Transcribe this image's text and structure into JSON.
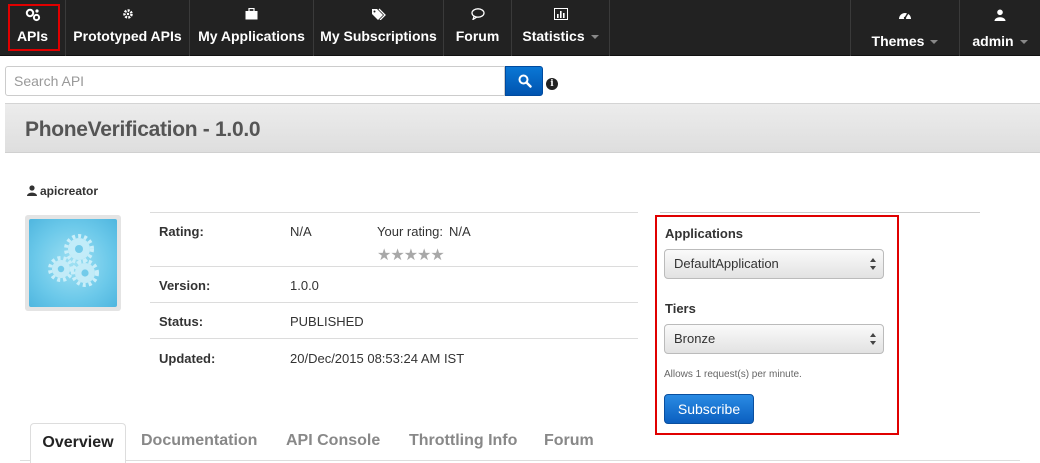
{
  "nav": {
    "items": [
      {
        "label": "APIs",
        "icon": "gears-icon"
      },
      {
        "label": "Prototyped APIs",
        "icon": "gear-icon"
      },
      {
        "label": "My Applications",
        "icon": "briefcase-icon"
      },
      {
        "label": "My Subscriptions",
        "icon": "tags-icon"
      },
      {
        "label": "Forum",
        "icon": "comment-icon"
      },
      {
        "label": "Statistics",
        "icon": "chart-icon"
      }
    ],
    "themes_label": "Themes",
    "user_label": "admin"
  },
  "search": {
    "placeholder": "Search API"
  },
  "api": {
    "title": "PhoneVerification - 1.0.0",
    "creator": "apicreator",
    "details": {
      "rating_label": "Rating:",
      "rating_value": "N/A",
      "your_rating_label": "Your rating:",
      "your_rating_value": "N/A",
      "stars": "★★★★★",
      "version_label": "Version:",
      "version_value": "1.0.0",
      "status_label": "Status:",
      "status_value": "PUBLISHED",
      "updated_label": "Updated:",
      "updated_value": "20/Dec/2015 08:53:24 AM IST"
    }
  },
  "subscribe": {
    "applications_label": "Applications",
    "application_selected": "DefaultApplication",
    "tiers_label": "Tiers",
    "tier_selected": "Bronze",
    "tier_description": "Allows 1 request(s) per minute.",
    "button_label": "Subscribe"
  },
  "tabs": [
    "Overview",
    "Documentation",
    "API Console",
    "Throttling Info",
    "Forum"
  ],
  "colors": {
    "nav_bg": "#222222",
    "highlight": "#e00000",
    "primary_button": "#0b5fc0"
  }
}
